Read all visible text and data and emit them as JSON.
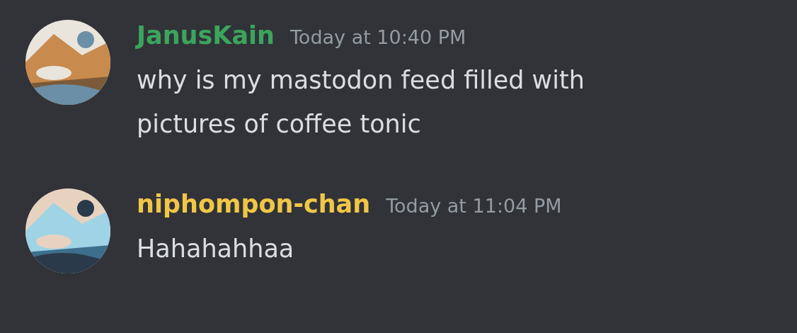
{
  "messages": [
    {
      "author": "JanusKain",
      "color": "#3ba55c",
      "timestamp": "Today at 10:40 PM",
      "lines": [
        "why is my mastodon feed filled with",
        "pictures of coffee tonic"
      ]
    },
    {
      "author": "niphompon-chan",
      "color": "#f0c646",
      "timestamp": "Today at 11:04 PM",
      "lines": [
        "Hahahahhaa"
      ]
    }
  ]
}
